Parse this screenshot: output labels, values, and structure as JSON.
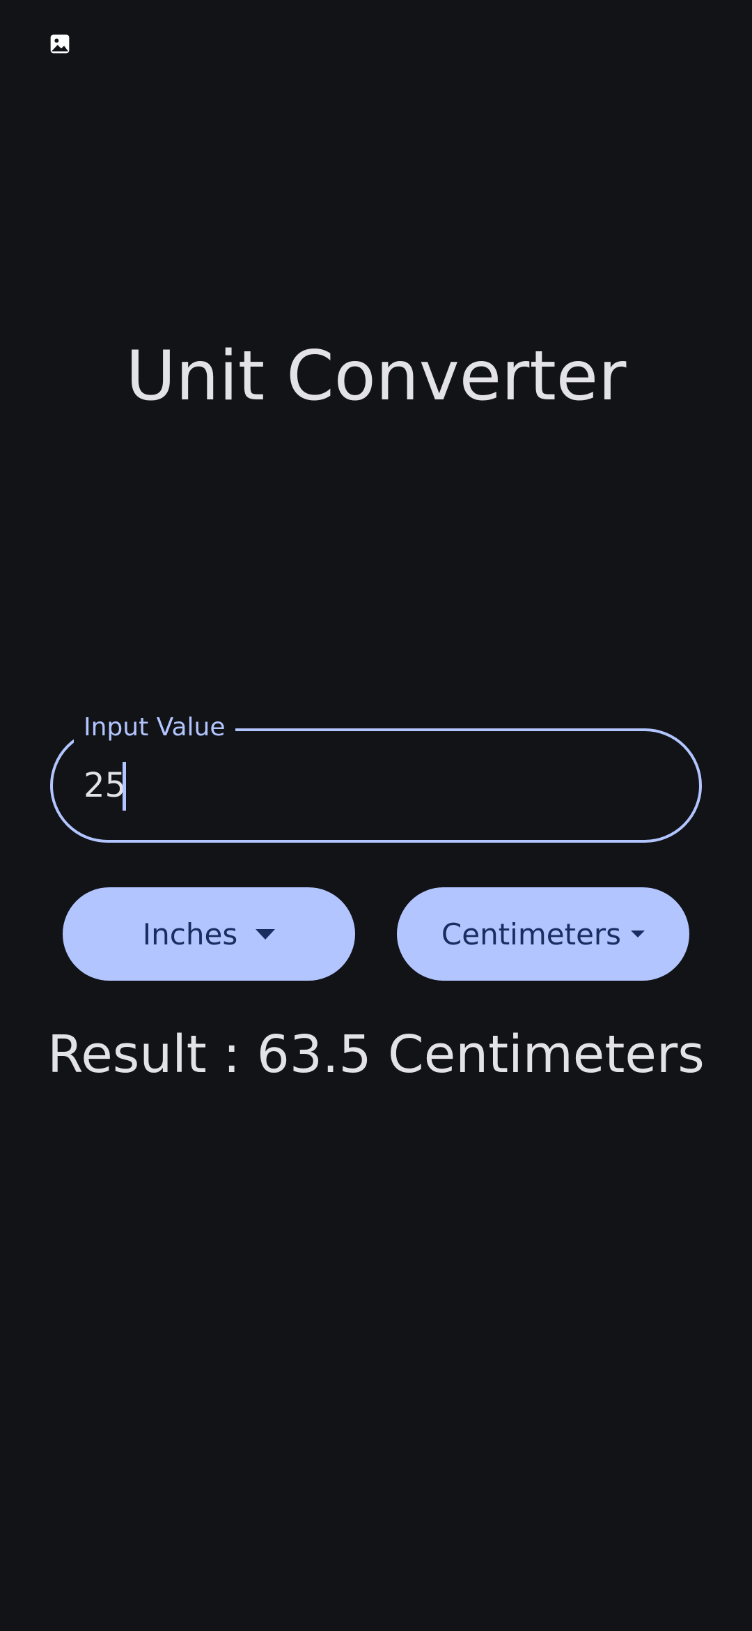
{
  "status_bar": {
    "icon": "image-icon"
  },
  "app": {
    "title": "Unit Converter"
  },
  "input": {
    "label": "Input Value",
    "value": "25"
  },
  "units": {
    "from": "Inches",
    "to": "Centimeters"
  },
  "result": {
    "text": "Result : 63.5 Centimeters"
  },
  "colors": {
    "background": "#121317",
    "accent": "#b3c5ff",
    "on_accent": "#1a2d60",
    "text": "#e3e2e6"
  }
}
